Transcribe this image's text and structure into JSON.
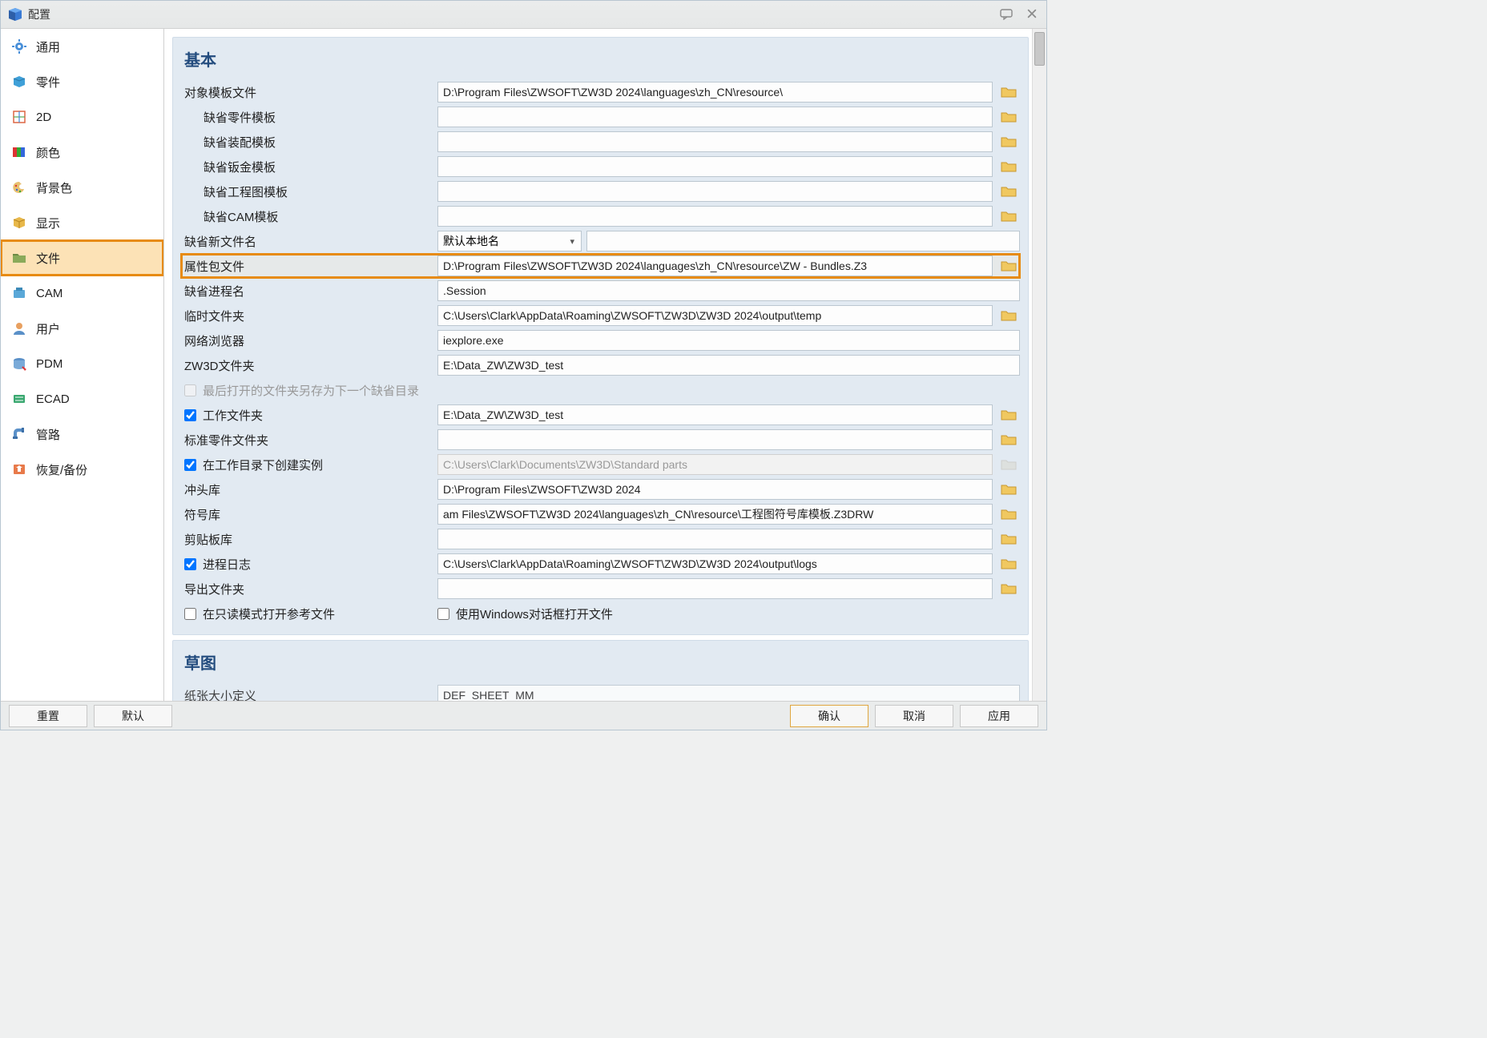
{
  "window": {
    "title": "配置"
  },
  "sidebar": {
    "items": [
      {
        "label": "通用"
      },
      {
        "label": "零件"
      },
      {
        "label": "2D"
      },
      {
        "label": "颜色"
      },
      {
        "label": "背景色"
      },
      {
        "label": "显示"
      },
      {
        "label": "文件"
      },
      {
        "label": "CAM"
      },
      {
        "label": "用户"
      },
      {
        "label": "PDM"
      },
      {
        "label": "ECAD"
      },
      {
        "label": "管路"
      },
      {
        "label": "恢复/备份"
      }
    ],
    "active_index": 6
  },
  "groups": {
    "basic": {
      "title": "基本",
      "rows": {
        "object_template": {
          "label": "对象模板文件",
          "value": "D:\\Program Files\\ZWSOFT\\ZW3D 2024\\languages\\zh_CN\\resource\\"
        },
        "default_part_template": {
          "label": "缺省零件模板",
          "value": ""
        },
        "default_assembly_template": {
          "label": "缺省装配模板",
          "value": ""
        },
        "default_sheetmetal_template": {
          "label": "缺省钣金模板",
          "value": ""
        },
        "default_drawing_template": {
          "label": "缺省工程图模板",
          "value": ""
        },
        "default_cam_template": {
          "label": "缺省CAM模板",
          "value": ""
        },
        "default_new_filename": {
          "label": "缺省新文件名",
          "combo": "默认本地名",
          "value": ""
        },
        "attr_bundle_file": {
          "label": "属性包文件",
          "value": "D:\\Program Files\\ZWSOFT\\ZW3D 2024\\languages\\zh_CN\\resource\\ZW - Bundles.Z3"
        },
        "default_session_name": {
          "label": "缺省进程名",
          "value": ".Session"
        },
        "temp_folder": {
          "label": "临时文件夹",
          "value": "C:\\Users\\Clark\\AppData\\Roaming\\ZWSOFT\\ZW3D\\ZW3D 2024\\output\\temp"
        },
        "web_browser": {
          "label": "网络浏览器",
          "value": "iexplore.exe"
        },
        "zw3d_folder": {
          "label": "ZW3D文件夹",
          "value": "E:\\Data_ZW\\ZW3D_test"
        },
        "last_folder_as_default": {
          "label": "最后打开的文件夹另存为下一个缺省目录"
        },
        "working_folder": {
          "label": "工作文件夹",
          "value": "E:\\Data_ZW\\ZW3D_test"
        },
        "std_parts_folder": {
          "label": "标准零件文件夹",
          "value": ""
        },
        "create_in_working_dir": {
          "label": "在工作目录下创建实例",
          "value": "C:\\Users\\Clark\\Documents\\ZW3D\\Standard parts"
        },
        "punch_library": {
          "label": "冲头库",
          "value": "D:\\Program Files\\ZWSOFT\\ZW3D 2024"
        },
        "symbol_library": {
          "label": "符号库",
          "value": "am Files\\ZWSOFT\\ZW3D 2024\\languages\\zh_CN\\resource\\工程图符号库模板.Z3DRW"
        },
        "scrap_library": {
          "label": "剪贴板库",
          "value": ""
        },
        "process_log": {
          "label": "进程日志",
          "value": "C:\\Users\\Clark\\AppData\\Roaming\\ZWSOFT\\ZW3D\\ZW3D 2024\\output\\logs"
        },
        "export_folder": {
          "label": "导出文件夹",
          "value": ""
        },
        "open_ref_readonly": {
          "label": "在只读模式打开参考文件"
        },
        "use_windows_dialog": {
          "label": "使用Windows对话框打开文件"
        }
      }
    },
    "sketch": {
      "title": "草图",
      "rows": {
        "paper_size_def": {
          "label": "纸张大小定义",
          "value": "DEF_SHEET_MM"
        }
      }
    }
  },
  "buttons": {
    "reset": "重置",
    "default": "默认",
    "ok": "确认",
    "cancel": "取消",
    "apply": "应用"
  }
}
